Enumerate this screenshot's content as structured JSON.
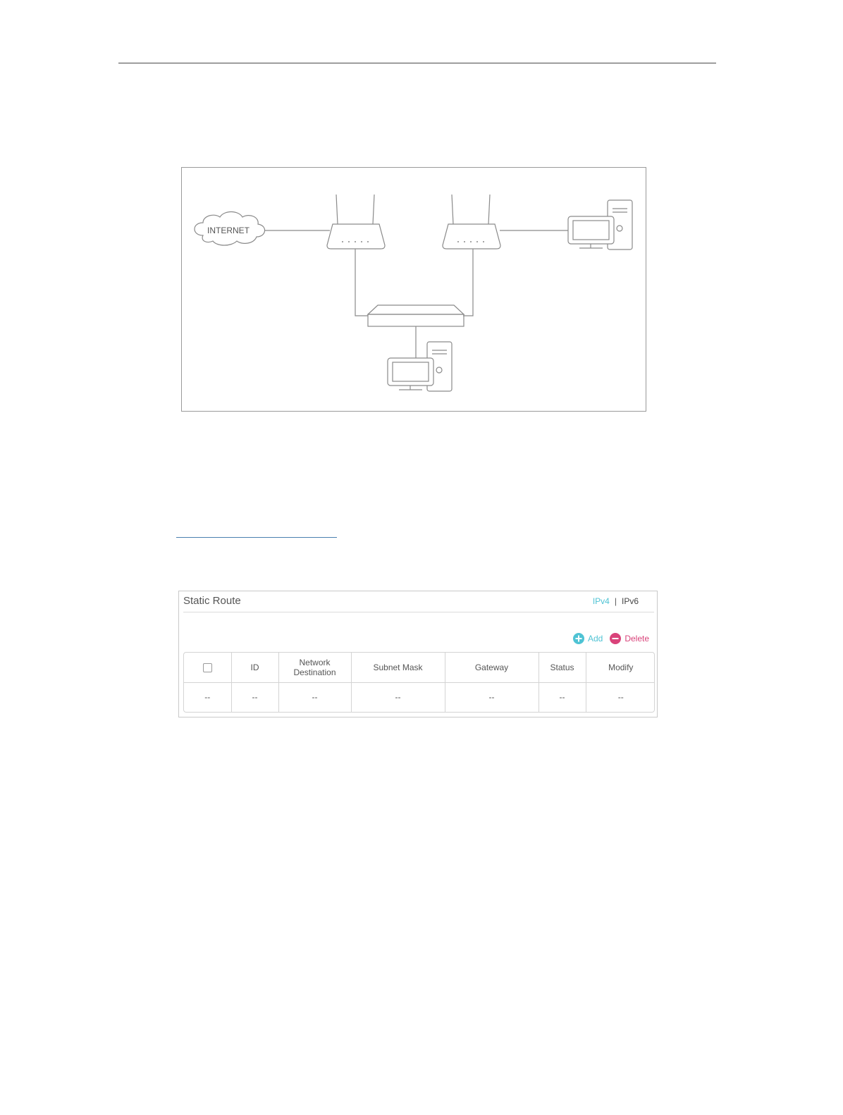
{
  "diagram": {
    "cloud_label": "INTERNET"
  },
  "static_route": {
    "title": "Static Route",
    "versions": {
      "ipv4": "IPv4",
      "separator": "|",
      "ipv6": "IPv6"
    },
    "actions": {
      "add": "Add",
      "delete": "Delete"
    },
    "columns": [
      "ID",
      "Network Destination",
      "Subnet Mask",
      "Gateway",
      "Status",
      "Modify"
    ],
    "rows": [
      [
        "--",
        "--",
        "--",
        "--",
        "--",
        "--",
        "--"
      ]
    ],
    "colors": {
      "accent": "#4fc3d4",
      "danger": "#d9437a"
    }
  }
}
